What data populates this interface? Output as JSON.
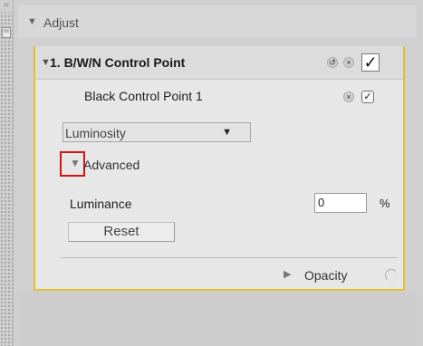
{
  "section": {
    "title": "Adjust"
  },
  "control_point": {
    "title": "1. B/W/N Control Point",
    "checked_mark": "✓"
  },
  "black_control_point": {
    "label": "Black Control Point 1",
    "checked_mark": "✓"
  },
  "dropdown": {
    "selected": "Luminosity"
  },
  "advanced": {
    "label": "Advanced"
  },
  "luminance": {
    "label": "Luminance",
    "value": "0",
    "unit": "%"
  },
  "reset": {
    "label": "Reset"
  },
  "opacity": {
    "label": "Opacity"
  },
  "colors": {
    "panel_border": "#e2c22a",
    "highlight": "#d01515"
  }
}
